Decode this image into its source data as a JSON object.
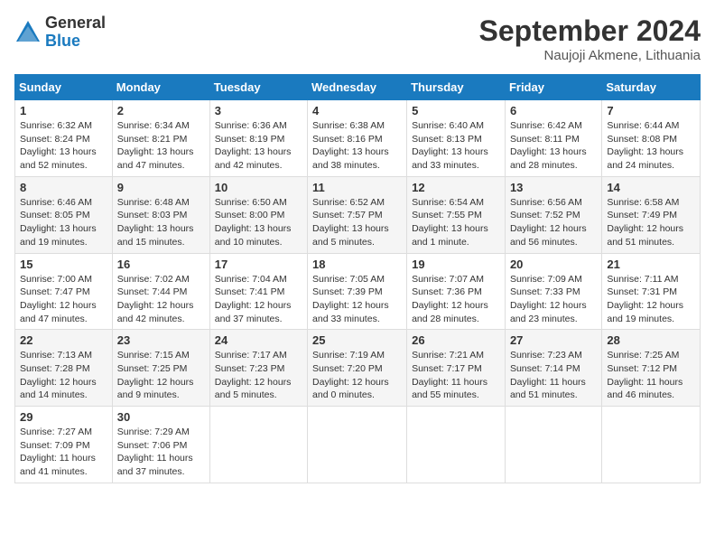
{
  "logo": {
    "general": "General",
    "blue": "Blue"
  },
  "title": {
    "month": "September 2024",
    "location": "Naujoji Akmene, Lithuania"
  },
  "headers": [
    "Sunday",
    "Monday",
    "Tuesday",
    "Wednesday",
    "Thursday",
    "Friday",
    "Saturday"
  ],
  "weeks": [
    [
      {
        "day": "1",
        "sunrise": "6:32 AM",
        "sunset": "8:24 PM",
        "daylight": "13 hours and 52 minutes."
      },
      {
        "day": "2",
        "sunrise": "6:34 AM",
        "sunset": "8:21 PM",
        "daylight": "13 hours and 47 minutes."
      },
      {
        "day": "3",
        "sunrise": "6:36 AM",
        "sunset": "8:19 PM",
        "daylight": "13 hours and 42 minutes."
      },
      {
        "day": "4",
        "sunrise": "6:38 AM",
        "sunset": "8:16 PM",
        "daylight": "13 hours and 38 minutes."
      },
      {
        "day": "5",
        "sunrise": "6:40 AM",
        "sunset": "8:13 PM",
        "daylight": "13 hours and 33 minutes."
      },
      {
        "day": "6",
        "sunrise": "6:42 AM",
        "sunset": "8:11 PM",
        "daylight": "13 hours and 28 minutes."
      },
      {
        "day": "7",
        "sunrise": "6:44 AM",
        "sunset": "8:08 PM",
        "daylight": "13 hours and 24 minutes."
      }
    ],
    [
      {
        "day": "8",
        "sunrise": "6:46 AM",
        "sunset": "8:05 PM",
        "daylight": "13 hours and 19 minutes."
      },
      {
        "day": "9",
        "sunrise": "6:48 AM",
        "sunset": "8:03 PM",
        "daylight": "13 hours and 15 minutes."
      },
      {
        "day": "10",
        "sunrise": "6:50 AM",
        "sunset": "8:00 PM",
        "daylight": "13 hours and 10 minutes."
      },
      {
        "day": "11",
        "sunrise": "6:52 AM",
        "sunset": "7:57 PM",
        "daylight": "13 hours and 5 minutes."
      },
      {
        "day": "12",
        "sunrise": "6:54 AM",
        "sunset": "7:55 PM",
        "daylight": "13 hours and 1 minute."
      },
      {
        "day": "13",
        "sunrise": "6:56 AM",
        "sunset": "7:52 PM",
        "daylight": "12 hours and 56 minutes."
      },
      {
        "day": "14",
        "sunrise": "6:58 AM",
        "sunset": "7:49 PM",
        "daylight": "12 hours and 51 minutes."
      }
    ],
    [
      {
        "day": "15",
        "sunrise": "7:00 AM",
        "sunset": "7:47 PM",
        "daylight": "12 hours and 47 minutes."
      },
      {
        "day": "16",
        "sunrise": "7:02 AM",
        "sunset": "7:44 PM",
        "daylight": "12 hours and 42 minutes."
      },
      {
        "day": "17",
        "sunrise": "7:04 AM",
        "sunset": "7:41 PM",
        "daylight": "12 hours and 37 minutes."
      },
      {
        "day": "18",
        "sunrise": "7:05 AM",
        "sunset": "7:39 PM",
        "daylight": "12 hours and 33 minutes."
      },
      {
        "day": "19",
        "sunrise": "7:07 AM",
        "sunset": "7:36 PM",
        "daylight": "12 hours and 28 minutes."
      },
      {
        "day": "20",
        "sunrise": "7:09 AM",
        "sunset": "7:33 PM",
        "daylight": "12 hours and 23 minutes."
      },
      {
        "day": "21",
        "sunrise": "7:11 AM",
        "sunset": "7:31 PM",
        "daylight": "12 hours and 19 minutes."
      }
    ],
    [
      {
        "day": "22",
        "sunrise": "7:13 AM",
        "sunset": "7:28 PM",
        "daylight": "12 hours and 14 minutes."
      },
      {
        "day": "23",
        "sunrise": "7:15 AM",
        "sunset": "7:25 PM",
        "daylight": "12 hours and 9 minutes."
      },
      {
        "day": "24",
        "sunrise": "7:17 AM",
        "sunset": "7:23 PM",
        "daylight": "12 hours and 5 minutes."
      },
      {
        "day": "25",
        "sunrise": "7:19 AM",
        "sunset": "7:20 PM",
        "daylight": "12 hours and 0 minutes."
      },
      {
        "day": "26",
        "sunrise": "7:21 AM",
        "sunset": "7:17 PM",
        "daylight": "11 hours and 55 minutes."
      },
      {
        "day": "27",
        "sunrise": "7:23 AM",
        "sunset": "7:14 PM",
        "daylight": "11 hours and 51 minutes."
      },
      {
        "day": "28",
        "sunrise": "7:25 AM",
        "sunset": "7:12 PM",
        "daylight": "11 hours and 46 minutes."
      }
    ],
    [
      {
        "day": "29",
        "sunrise": "7:27 AM",
        "sunset": "7:09 PM",
        "daylight": "11 hours and 41 minutes."
      },
      {
        "day": "30",
        "sunrise": "7:29 AM",
        "sunset": "7:06 PM",
        "daylight": "11 hours and 37 minutes."
      },
      null,
      null,
      null,
      null,
      null
    ]
  ]
}
